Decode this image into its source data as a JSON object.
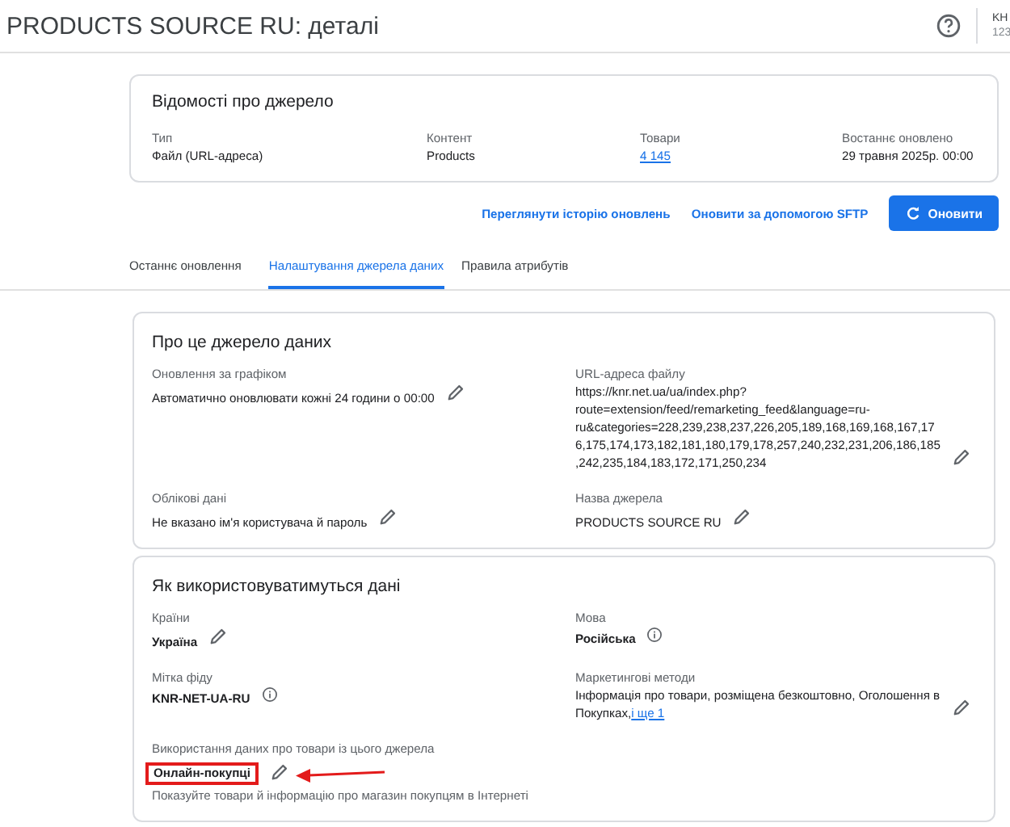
{
  "header": {
    "title": "PRODUCTS SOURCE RU: деталі",
    "account_name": "KH",
    "account_id": "123"
  },
  "summary": {
    "title": "Відомості про джерело",
    "fields": [
      {
        "label": "Тип",
        "value": "Файл (URL-адреса)",
        "kind": "text"
      },
      {
        "label": "Контент",
        "value": "Products",
        "kind": "text"
      },
      {
        "label": "Товари",
        "value": "4 145",
        "kind": "link"
      },
      {
        "label": "Востаннє оновлено",
        "value": "29 травня 2025р. 00:00",
        "kind": "text"
      }
    ]
  },
  "actions": [
    {
      "label": "Переглянути історію оновлень",
      "kind": "link"
    },
    {
      "label": "Оновити за допомогою SFTP",
      "kind": "link"
    },
    {
      "label": "Оновити",
      "kind": "primary"
    }
  ],
  "tabs": [
    {
      "label": "Останнє оновлення",
      "selected": false
    },
    {
      "label": "Налаштування джерела даних",
      "selected": true
    },
    {
      "label": "Правила атрибутів",
      "selected": false
    }
  ],
  "sections": [
    {
      "title": "Про це джерело даних",
      "fields": [
        {
          "label": "Оновлення за графіком",
          "value": "Автоматично оновлювати кожні 24 години о 00:00",
          "bold": false,
          "kind": "editable"
        },
        {
          "label": "URL-адреса файлу",
          "value": "https://knr.net.ua/ua/index.php?route=extension/feed/remarketing_feed&language=ru-ru&categories=228,239,238,237,226,205,189,168,169,168,167,176,175,174,173,182,181,180,179,178,257,240,232,231,206,186,185,242,235,184,183,172,171,250,234",
          "bold": false,
          "kind": "editable"
        },
        {
          "label": "Облікові дані",
          "value": "Не вказано ім'я користувача й пароль",
          "bold": false,
          "kind": "editable"
        },
        {
          "label": "Назва джерела",
          "value": "PRODUCTS SOURCE RU",
          "bold": false,
          "kind": "editable"
        }
      ]
    },
    {
      "title": "Як використовуватимуться дані",
      "fields": [
        {
          "label": "Країни",
          "value": "Україна",
          "bold": true,
          "kind": "editable"
        },
        {
          "label": "Мова",
          "value": "Російська",
          "bold": true,
          "kind": "info"
        },
        {
          "label": "Мітка фіду",
          "value": "KNR-NET-UA-RU",
          "bold": true,
          "kind": "info"
        },
        {
          "label": "Маркетингові методи",
          "value": "Інформація про товари, розміщена безкоштовно, Оголошення в Покупках,",
          "link": "і ще 1",
          "bold": false,
          "kind": "editable"
        },
        {
          "label": "Використання даних про товари із цього джерела",
          "value": "Онлайн-покупці",
          "bold": true,
          "kind": "editable",
          "highlighted": true,
          "description": "Показуйте товари й інформацію про магазин покупцям в Інтернеті"
        }
      ]
    }
  ]
}
